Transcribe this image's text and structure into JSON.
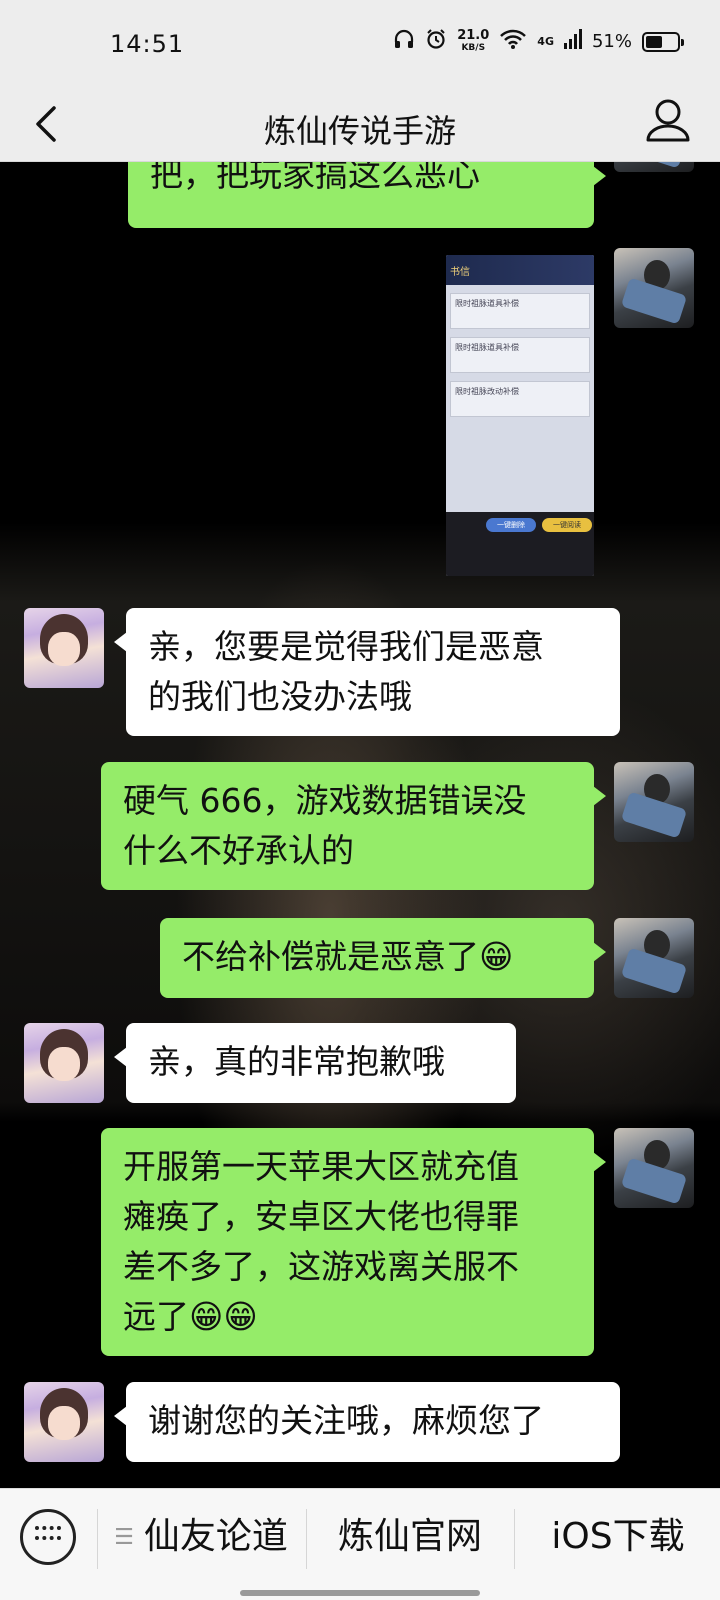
{
  "status_bar": {
    "time": "14:51",
    "net_speed_value": "21.0",
    "net_speed_unit": "KB/S",
    "signal": "4G",
    "battery": "51%"
  },
  "header": {
    "title": "炼仙传说手游"
  },
  "messages": [
    {
      "side": "right",
      "type": "text",
      "text": "把，把玩家搞这么恶心"
    },
    {
      "side": "right",
      "type": "image"
    },
    {
      "side": "left",
      "type": "text",
      "lines": [
        "亲，您要是觉得我们是恶意",
        "的我们也没办法哦"
      ]
    },
    {
      "side": "right",
      "type": "text",
      "lines": [
        "硬气 666，游戏数据错误没",
        "什么不好承认的"
      ]
    },
    {
      "side": "right",
      "type": "text",
      "text": "不给补偿就是恶意了😁"
    },
    {
      "side": "left",
      "type": "text",
      "text": "亲，真的非常抱歉哦"
    },
    {
      "side": "right",
      "type": "text",
      "lines": [
        "开服第一天苹果大区就充值",
        "瘫痪了，安卓区大佬也得罪",
        "差不多了，这游戏离关服不",
        "远了😁😁"
      ]
    },
    {
      "side": "left",
      "type": "text",
      "text": "谢谢您的关注哦，麻烦您了"
    }
  ],
  "image_message": {
    "header": "书信",
    "rows": [
      "限时祖脉道具补偿",
      "限时祖脉道具补偿",
      "限时祖脉改动补偿"
    ],
    "buttons": [
      "一键删除",
      "一键阅读"
    ]
  },
  "bottom_menu": {
    "items": [
      "仙友论道",
      "炼仙官网",
      "iOS下载"
    ]
  },
  "colors": {
    "my_bubble": "#95ec69",
    "their_bubble": "#ffffff",
    "bar_bg": "#ededed"
  }
}
